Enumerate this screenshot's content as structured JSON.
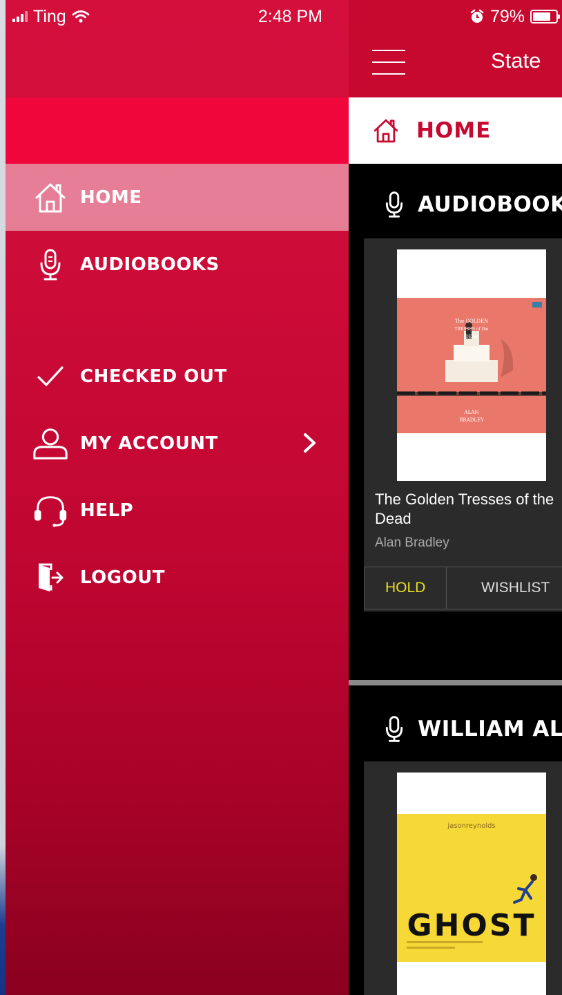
{
  "status_bar": {
    "carrier": "Ting",
    "time": "2:48 PM",
    "battery": "79%",
    "battery_level": 0.79
  },
  "drawer": {
    "items": [
      {
        "label": "HOME",
        "icon": "home-icon",
        "active": true
      },
      {
        "label": "AUDIOBOOKS",
        "icon": "microphone-icon",
        "active": false
      },
      {
        "label": "CHECKED OUT",
        "icon": "checkmark-icon",
        "active": false
      },
      {
        "label": "MY ACCOUNT",
        "icon": "user-icon",
        "active": false,
        "has_submenu": true
      },
      {
        "label": "HELP",
        "icon": "headset-icon",
        "active": false
      },
      {
        "label": "LOGOUT",
        "icon": "logout-icon",
        "active": false
      }
    ]
  },
  "main": {
    "app_title": "State",
    "current_page": "HOME",
    "sections": [
      {
        "title": "AUDIOBOOK",
        "book": {
          "title": "The Golden Tresses of the Dead",
          "author": "Alan Bradley",
          "cover_text": [
            "The GOLDEN",
            "TRESSES of the",
            "DEAD",
            "ALAN",
            "BRADLEY"
          ],
          "actions": [
            "HOLD",
            "WISHLIST"
          ]
        }
      },
      {
        "title": "WILLIAM AL",
        "book": {
          "cover_author": "jasonreynolds",
          "cover_title": "GHOST"
        }
      }
    ]
  },
  "colors": {
    "brand_red": "#c7092f",
    "banner_red": "#f0063b",
    "hold_yellow": "#e9e020",
    "ghost_yellow": "#f6d836"
  }
}
